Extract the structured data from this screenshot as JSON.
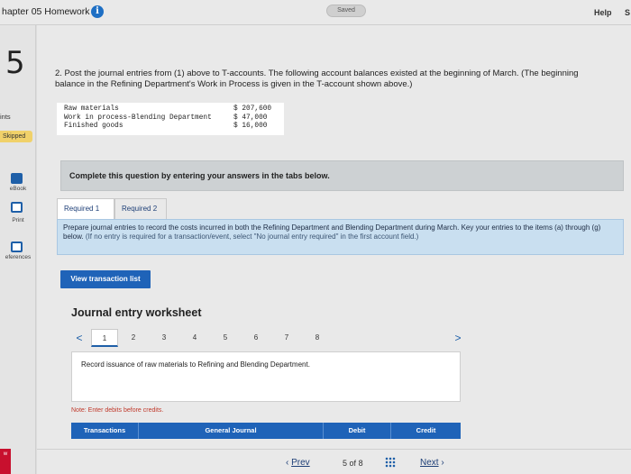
{
  "header": {
    "title": "hapter 05 Homework",
    "saved_label": "Saved",
    "help_label": "Help",
    "cut_label": "S"
  },
  "sidebar": {
    "question_number": "5",
    "points_label": "ints",
    "status_label": "Skipped",
    "ebook_label": "eBook",
    "print_label": "Print",
    "references_label": "eferences",
    "corner_label": "w"
  },
  "question": {
    "text": "2. Post the journal entries from (1) above to T-accounts. The following account balances existed at the beginning of March. (The beginning balance in the Refining Department's Work in Process is given in the T-account shown above.)",
    "balances": [
      {
        "account": "Raw materials",
        "amount": "$ 207,600"
      },
      {
        "account": "Work in process-Blending Department",
        "amount": "$ 47,000"
      },
      {
        "account": "Finished goods",
        "amount": "$ 16,000"
      }
    ]
  },
  "instruction": "Complete this question by entering your answers in the tabs below.",
  "tabs": [
    {
      "label": "Required 1",
      "active": true
    },
    {
      "label": "Required 2",
      "active": false
    }
  ],
  "tab_panel": {
    "text": "Prepare journal entries to record the costs incurred in both the Refining Department and Blending Department during March. Key your entries to the items (a) through (g) below.",
    "note": "(If no entry is required for a transaction/event, select \"No journal entry required\" in the first account field.)"
  },
  "view_transaction_label": "View transaction list",
  "worksheet": {
    "title": "Journal entry worksheet",
    "pages": [
      "1",
      "2",
      "3",
      "4",
      "5",
      "6",
      "7",
      "8"
    ],
    "active_page": "1",
    "prev_arrow": "<",
    "next_arrow": ">",
    "record_text": "Record issuance of raw materials to Refining and Blending Department.",
    "note": "Note: Enter debits before credits.",
    "columns": [
      "Transactions",
      "General Journal",
      "Debit",
      "Credit"
    ]
  },
  "footer": {
    "prev_label": "Prev",
    "prev_icon": "‹",
    "page_current": "5",
    "page_of": "of",
    "page_total": "8",
    "next_label": "Next",
    "next_icon": "›"
  },
  "colors": {
    "accent": "#1f63b8",
    "skipped": "#f0d16a",
    "panel": "#c9dff0"
  }
}
